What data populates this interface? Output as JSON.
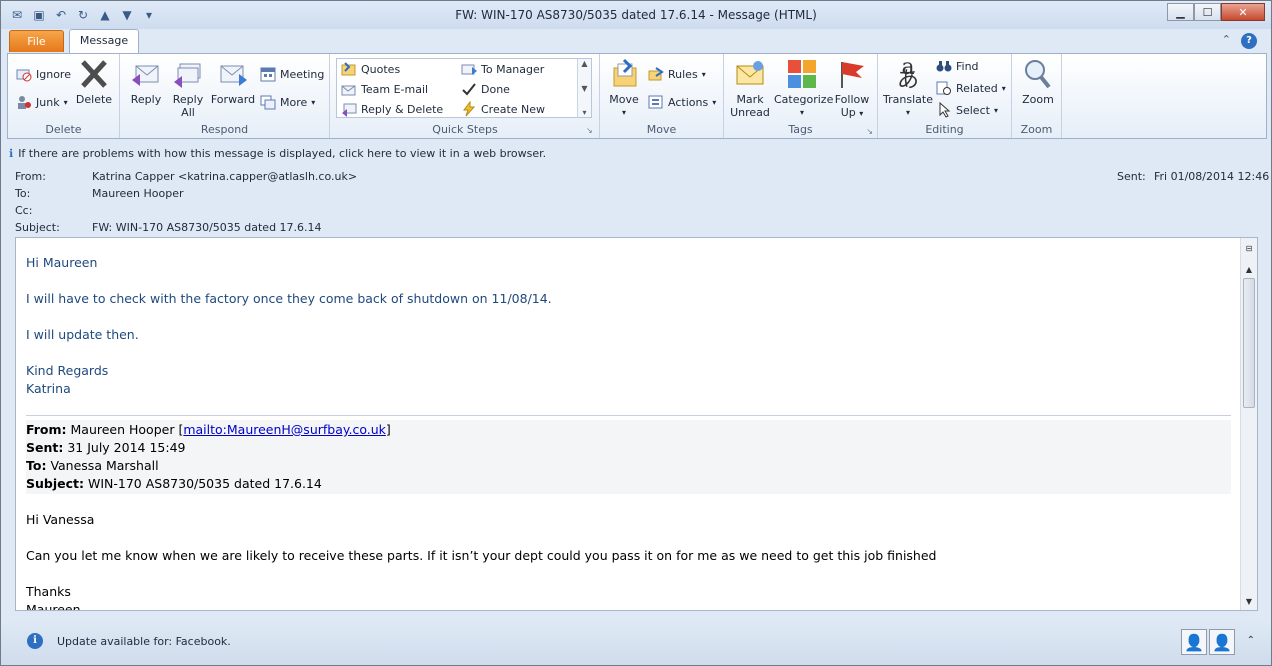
{
  "window": {
    "title": "FW: WIN-170  AS8730/5035 dated 17.6.14  -  Message (HTML)",
    "minimize_icon": "minimize-icon",
    "maximize_icon": "maximize-icon",
    "close_icon": "close-icon"
  },
  "tabs": {
    "file": "File",
    "message": "Message"
  },
  "ribbon": {
    "delete_group": {
      "label": "Delete",
      "ignore": "Ignore",
      "junk": "Junk",
      "delete": "Delete"
    },
    "respond_group": {
      "label": "Respond",
      "reply": "Reply",
      "reply_all_1": "Reply",
      "reply_all_2": "All",
      "forward": "Forward",
      "meeting": "Meeting",
      "more": "More"
    },
    "quicksteps_group": {
      "label": "Quick Steps",
      "items": [
        "Quotes",
        "To Manager",
        "Team E-mail",
        "Done",
        "Reply & Delete",
        "Create New"
      ]
    },
    "move_group": {
      "label": "Move",
      "move": "Move",
      "rules": "Rules",
      "actions": "Actions"
    },
    "tags_group": {
      "label": "Tags",
      "mark_unread_1": "Mark",
      "mark_unread_2": "Unread",
      "categorize": "Categorize",
      "follow_up_1": "Follow",
      "follow_up_2": "Up"
    },
    "editing_group": {
      "label": "Editing",
      "translate": "Translate",
      "find": "Find",
      "related": "Related",
      "select": "Select"
    },
    "zoom_group": {
      "label": "Zoom",
      "zoom": "Zoom"
    }
  },
  "infobar": "If there are problems with how this message is displayed, click here to view it in a web browser.",
  "header": {
    "from_label": "From:",
    "from_value": "Katrina Capper <katrina.capper@atlaslh.co.uk>",
    "to_label": "To:",
    "to_value": "Maureen Hooper",
    "cc_label": "Cc:",
    "cc_value": "",
    "subject_label": "Subject:",
    "subject_value": "FW: WIN-170  AS8730/5035 dated 17.6.14",
    "sent_label": "Sent:",
    "sent_value": "Fri 01/08/2014 12:46"
  },
  "body": {
    "greeting": "Hi Maureen",
    "line1": "I will have to check with the factory once they come back of shutdown on 11/08/14.",
    "line2": "I will update then.",
    "regards": "Kind Regards",
    "signature": "Katrina",
    "fwd": {
      "from_label": "From:",
      "from_name": "Maureen Hooper [",
      "from_link": "mailto:MaureenH@surfbay.co.uk",
      "from_end": "]",
      "sent_label": "Sent:",
      "sent_value": "31 July 2014 15:49",
      "to_label": "To:",
      "to_value": "Vanessa Marshall",
      "subject_label": "Subject:",
      "subject_value": "WIN-170 AS8730/5035 dated 17.6.14"
    },
    "fwd_greeting": "Hi Vanessa",
    "fwd_line1": "Can you let me know when we are likely to receive these parts. If it isn’t your dept could you pass it on for me as we need to get this job finished",
    "fwd_thanks": "Thanks",
    "fwd_sig": "Maureen"
  },
  "status": {
    "text": "Update available for: Facebook."
  }
}
